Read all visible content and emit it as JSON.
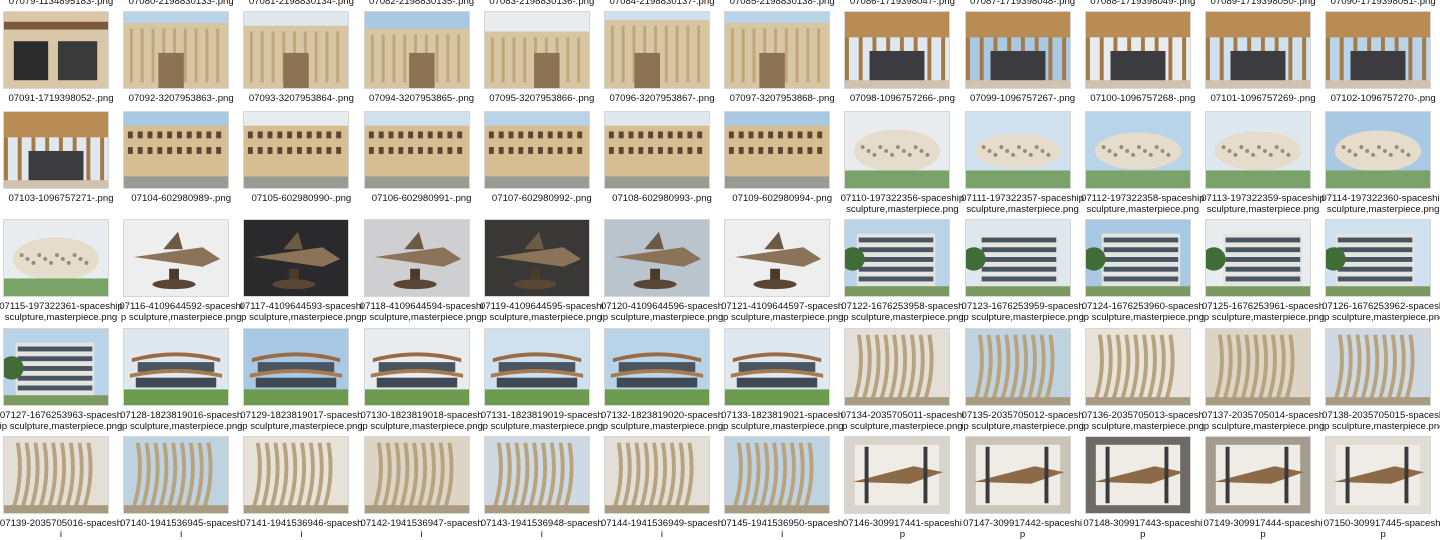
{
  "top_partial_labels": [
    "07079-1134895183-.png",
    "07080-2198830133-.png",
    "07081-2198830134-.png",
    "07082-2198830135-.png",
    "07083-2198830136-.png",
    "07084-2198830137-.png",
    "07085-2198830138-.png",
    "07086-1719398047-.png",
    "07087-1719398048-.png",
    "07088-1719398049-.png",
    "07089-1719398050-.png",
    "07090-1719398051-.png"
  ],
  "rows": [
    [
      {
        "name": "07091-1719398052-.png",
        "kind": "mod"
      },
      {
        "name": "07092-3207953863-.png",
        "kind": "beige"
      },
      {
        "name": "07093-3207953864-.png",
        "kind": "beige"
      },
      {
        "name": "07094-3207953865-.png",
        "kind": "beige"
      },
      {
        "name": "07095-3207953866-.png",
        "kind": "beige"
      },
      {
        "name": "07096-3207953867-.png",
        "kind": "beige"
      },
      {
        "name": "07097-3207953868-.png",
        "kind": "beige"
      },
      {
        "name": "07098-1096757266-.png",
        "kind": "wood"
      },
      {
        "name": "07099-1096757267-.png",
        "kind": "wood"
      },
      {
        "name": "07100-1096757268-.png",
        "kind": "wood"
      },
      {
        "name": "07101-1096757269-.png",
        "kind": "wood"
      },
      {
        "name": "07102-1096757270-.png",
        "kind": "wood"
      }
    ],
    [
      {
        "name": "07103-1096757271-.png",
        "kind": "wood"
      },
      {
        "name": "07104-602980989-.png",
        "kind": "facade"
      },
      {
        "name": "07105-602980990-.png",
        "kind": "facade"
      },
      {
        "name": "07106-602980991-.png",
        "kind": "facade"
      },
      {
        "name": "07107-602980992-.png",
        "kind": "facade"
      },
      {
        "name": "07108-602980993-.png",
        "kind": "facade"
      },
      {
        "name": "07109-602980994-.png",
        "kind": "facade"
      },
      {
        "name": "07110-197322356-spaceship sculpture,masterpiece.png",
        "kind": "sculpt"
      },
      {
        "name": "07111-197322357-spaceship sculpture,masterpiece.png",
        "kind": "sculpt"
      },
      {
        "name": "07112-197322358-spaceship sculpture,masterpiece.png",
        "kind": "sculpt"
      },
      {
        "name": "07113-197322359-spaceship sculpture,masterpiece.png",
        "kind": "sculpt"
      },
      {
        "name": "07114-197322360-spaceship sculpture,masterpiece.png",
        "kind": "sculpt"
      }
    ],
    [
      {
        "name": "07115-197322361-spaceship sculpture,masterpiece.png",
        "kind": "sculpt"
      },
      {
        "name": "07116-4109644592-spaceship sculpture,masterpiece.png",
        "kind": "ship"
      },
      {
        "name": "07117-4109644593-spaceship sculpture,masterpiece.png",
        "kind": "ship"
      },
      {
        "name": "07118-4109644594-spaceship sculpture,masterpiece.png",
        "kind": "ship"
      },
      {
        "name": "07119-4109644595-spaceship sculpture,masterpiece.png",
        "kind": "ship"
      },
      {
        "name": "07120-4109644596-spaceship sculpture,masterpiece.png",
        "kind": "ship"
      },
      {
        "name": "07121-4109644597-spaceship sculpture,masterpiece.png",
        "kind": "ship"
      },
      {
        "name": "07122-1676253958-spaceship sculpture,masterpiece.png",
        "kind": "glass"
      },
      {
        "name": "07123-1676253959-spaceship sculpture,masterpiece.png",
        "kind": "glass"
      },
      {
        "name": "07124-1676253960-spaceship sculpture,masterpiece.png",
        "kind": "glass"
      },
      {
        "name": "07125-1676253961-spaceship sculpture,masterpiece.png",
        "kind": "glass"
      },
      {
        "name": "07126-1676253962-spaceship sculpture,masterpiece.png",
        "kind": "glass"
      }
    ],
    [
      {
        "name": "07127-1676253963-spaceship sculpture,masterpiece.png",
        "kind": "glass"
      },
      {
        "name": "07128-1823819016-spaceship sculpture,masterpiece.png",
        "kind": "terrace"
      },
      {
        "name": "07129-1823819017-spaceship sculpture,masterpiece.png",
        "kind": "terrace"
      },
      {
        "name": "07130-1823819018-spaceship sculpture,masterpiece.png",
        "kind": "terrace"
      },
      {
        "name": "07131-1823819019-spaceship sculpture,masterpiece.png",
        "kind": "terrace"
      },
      {
        "name": "07132-1823819020-spaceship sculpture,masterpiece.png",
        "kind": "terrace"
      },
      {
        "name": "07133-1823819021-spaceship sculpture,masterpiece.png",
        "kind": "terrace"
      },
      {
        "name": "07134-2035705011-spaceship sculpture,masterpiece.png",
        "kind": "curve"
      },
      {
        "name": "07135-2035705012-spaceship sculpture,masterpiece.png",
        "kind": "curve"
      },
      {
        "name": "07136-2035705013-spaceship sculpture,masterpiece.png",
        "kind": "curve"
      },
      {
        "name": "07137-2035705014-spaceship sculpture,masterpiece.png",
        "kind": "curve"
      },
      {
        "name": "07138-2035705015-spaceship sculpture,masterpiece.png",
        "kind": "curve"
      }
    ],
    [
      {
        "name": "07139-2035705016-spaceshi",
        "kind": "curve"
      },
      {
        "name": "07140-1941536945-spaceshi",
        "kind": "curve"
      },
      {
        "name": "07141-1941536946-spaceshi",
        "kind": "curve"
      },
      {
        "name": "07142-1941536947-spaceshi",
        "kind": "curve"
      },
      {
        "name": "07143-1941536948-spaceshi",
        "kind": "curve"
      },
      {
        "name": "07144-1941536949-spaceshi",
        "kind": "curve"
      },
      {
        "name": "07145-1941536950-spaceshi",
        "kind": "curve"
      },
      {
        "name": "07146-309917441-spaceship",
        "kind": "wing"
      },
      {
        "name": "07147-309917442-spaceship",
        "kind": "wing"
      },
      {
        "name": "07148-309917443-spaceship",
        "kind": "wing"
      },
      {
        "name": "07149-309917444-spaceship",
        "kind": "wing"
      },
      {
        "name": "07150-309917445-spaceship",
        "kind": "wing"
      }
    ]
  ]
}
